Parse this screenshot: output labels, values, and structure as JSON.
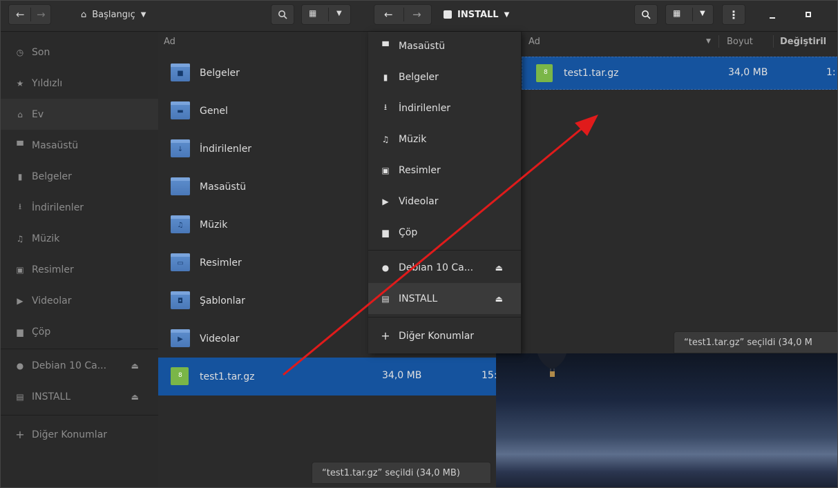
{
  "left_window": {
    "header": {
      "back_icon": "arrow-left-icon",
      "forward_icon": "arrow-right-icon",
      "location_icon": "home-icon",
      "location_label": "Başlangıç",
      "location_dropdown_icon": "chevron-down-icon",
      "search_icon": "search-icon",
      "view_icon": "grid-view-icon",
      "view_dropdown_icon": "chevron-down-icon"
    },
    "sidebar": {
      "items": [
        {
          "label": "Son",
          "icon": "clock-icon"
        },
        {
          "label": "Yıldızlı",
          "icon": "star-icon"
        },
        {
          "label": "Ev",
          "icon": "home-icon"
        },
        {
          "label": "Masaüstü",
          "icon": "desktop-icon"
        },
        {
          "label": "Belgeler",
          "icon": "document-icon"
        },
        {
          "label": "İndirilenler",
          "icon": "download-icon"
        },
        {
          "label": "Müzik",
          "icon": "music-icon"
        },
        {
          "label": "Resimler",
          "icon": "image-icon"
        },
        {
          "label": "Videolar",
          "icon": "video-icon"
        },
        {
          "label": "Çöp",
          "icon": "trash-icon"
        }
      ],
      "devices": [
        {
          "label": "Debian 10 Ca...",
          "icon": "disc-icon",
          "eject": "⏏"
        },
        {
          "label": "INSTALL",
          "icon": "drive-icon",
          "eject": "⏏"
        }
      ],
      "other_locations": "Diğer Konumlar"
    },
    "column_header": {
      "name": "Ad"
    },
    "files": [
      {
        "name": "Belgeler",
        "type": "folder",
        "glyph": "■"
      },
      {
        "name": "Genel",
        "type": "folder",
        "glyph": "▬"
      },
      {
        "name": "İndirilenler",
        "type": "folder",
        "glyph": "↓"
      },
      {
        "name": "Masaüstü",
        "type": "folder",
        "glyph": ""
      },
      {
        "name": "Müzik",
        "type": "folder",
        "glyph": "♫"
      },
      {
        "name": "Resimler",
        "type": "folder",
        "glyph": "▭"
      },
      {
        "name": "Şablonlar",
        "type": "folder",
        "glyph": "◘"
      },
      {
        "name": "Videolar",
        "type": "folder",
        "glyph": "▶"
      },
      {
        "name": "test1.tar.gz",
        "type": "archive",
        "size": "34,0 MB",
        "modified": "15:",
        "selected": true
      }
    ],
    "status": "“test1.tar.gz” seçildi  (34,0 MB)"
  },
  "right_window": {
    "header": {
      "back_icon": "arrow-left-icon",
      "forward_icon": "arrow-right-icon",
      "location_icon": "drive-icon",
      "location_label": "INSTALL",
      "location_dropdown_icon": "chevron-down-icon",
      "search_icon": "search-icon",
      "view_icon": "grid-view-icon",
      "view_dropdown_icon": "chevron-down-icon",
      "menu_icon": "kebab-menu-icon",
      "minimize_icon": "minimize-icon",
      "maximize_icon": "maximize-icon"
    },
    "sidebar_popover": {
      "items": [
        {
          "label": "Masaüstü",
          "icon": "desktop-icon"
        },
        {
          "label": "Belgeler",
          "icon": "document-icon"
        },
        {
          "label": "İndirilenler",
          "icon": "download-icon"
        },
        {
          "label": "Müzik",
          "icon": "music-icon"
        },
        {
          "label": "Resimler",
          "icon": "image-icon"
        },
        {
          "label": "Videolar",
          "icon": "video-icon"
        },
        {
          "label": "Çöp",
          "icon": "trash-icon"
        }
      ],
      "devices": [
        {
          "label": "Debian 10 Ca...",
          "icon": "disc-icon",
          "eject": "⏏"
        },
        {
          "label": "INSTALL",
          "icon": "drive-icon",
          "eject": "⏏"
        }
      ],
      "other_locations": "Diğer Konumlar"
    },
    "column_headers": {
      "name": "Ad",
      "size": "Boyut",
      "modified": "Değiştiril"
    },
    "files": [
      {
        "name": "test1.tar.gz",
        "type": "archive",
        "size": "34,0 MB",
        "modified": "1:",
        "selected": true
      }
    ],
    "status": "“test1.tar.gz” seçildi  (34,0 M"
  },
  "colors": {
    "selection": "#15539e",
    "arrow": "#e01b1b",
    "folder": "#4a78b8",
    "archive": "#7ab648"
  }
}
